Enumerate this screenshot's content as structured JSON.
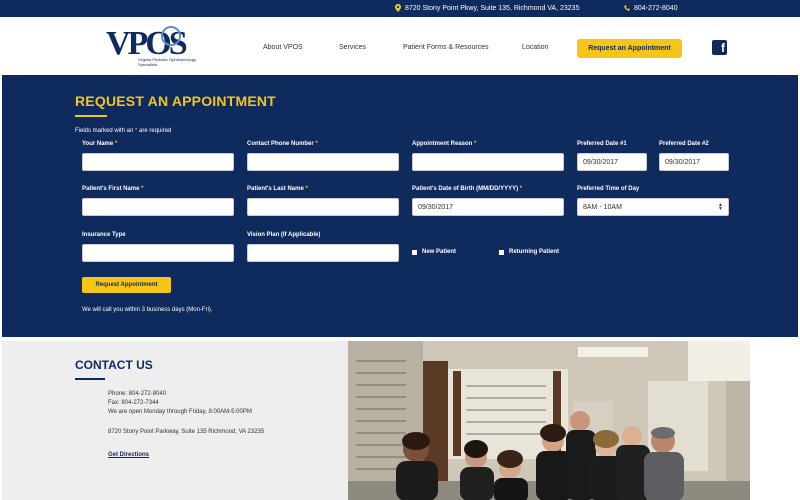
{
  "topbar": {
    "address": "8720 Stony Point Pkwy, Suite 135, Richmond VA, 23235",
    "phone": "804-272-8040"
  },
  "logo": {
    "name": "VPOS",
    "subtitle": "Virginia Pediatric Ophthalmology Specialists"
  },
  "nav": {
    "items": [
      "About VPOS",
      "Services",
      "Patient Forms & Resources",
      "Location"
    ],
    "cta": "Request an Appointment",
    "social_icon": "facebook-icon"
  },
  "form": {
    "title": "REQUEST AN APPOINTMENT",
    "required_note_a": "Fields marked with an ",
    "required_note_ast": "*",
    "required_note_b": " are required",
    "fields": {
      "your_name": "Your Name",
      "contact_phone": "Contact Phone Number",
      "appointment_reason": "Appointment Reason",
      "preferred_date_1": "Preferred Date #1",
      "preferred_date_2": "Preferred Date #2",
      "first_name": "Patient's First Name",
      "last_name": "Patient's Last Name",
      "dob": "Patient's Date of Birth (MM/DD/YYYY)",
      "preferred_time": "Preferred Time of Day",
      "insurance": "Insurance Type",
      "vision_plan": "Vision Plan (If Applicable)"
    },
    "values": {
      "date_1": "09/30/2017",
      "date_2": "09/30/2017",
      "dob": "09/30/2017",
      "time": "8AM - 10AM"
    },
    "asterisk": "*",
    "new_patient": "New Patient",
    "returning_patient": "Returning Patient",
    "submit": "Request Appointment",
    "callback_note": "We will call you within 3 business days (Mon-Fri)."
  },
  "contact": {
    "title": "CONTACT US",
    "phone": "Phone: 804-272-8040",
    "fax": "Fax: 804-272-7344",
    "hours": "We are open Monday through Friday, 8:00AM-5:00PM",
    "address": "8720 Stony Point Parkway, Suite 135 Richmond, VA 23235",
    "directions": "Get Directions"
  },
  "colors": {
    "navy": "#0f2a5c",
    "gold": "#f5c518"
  }
}
